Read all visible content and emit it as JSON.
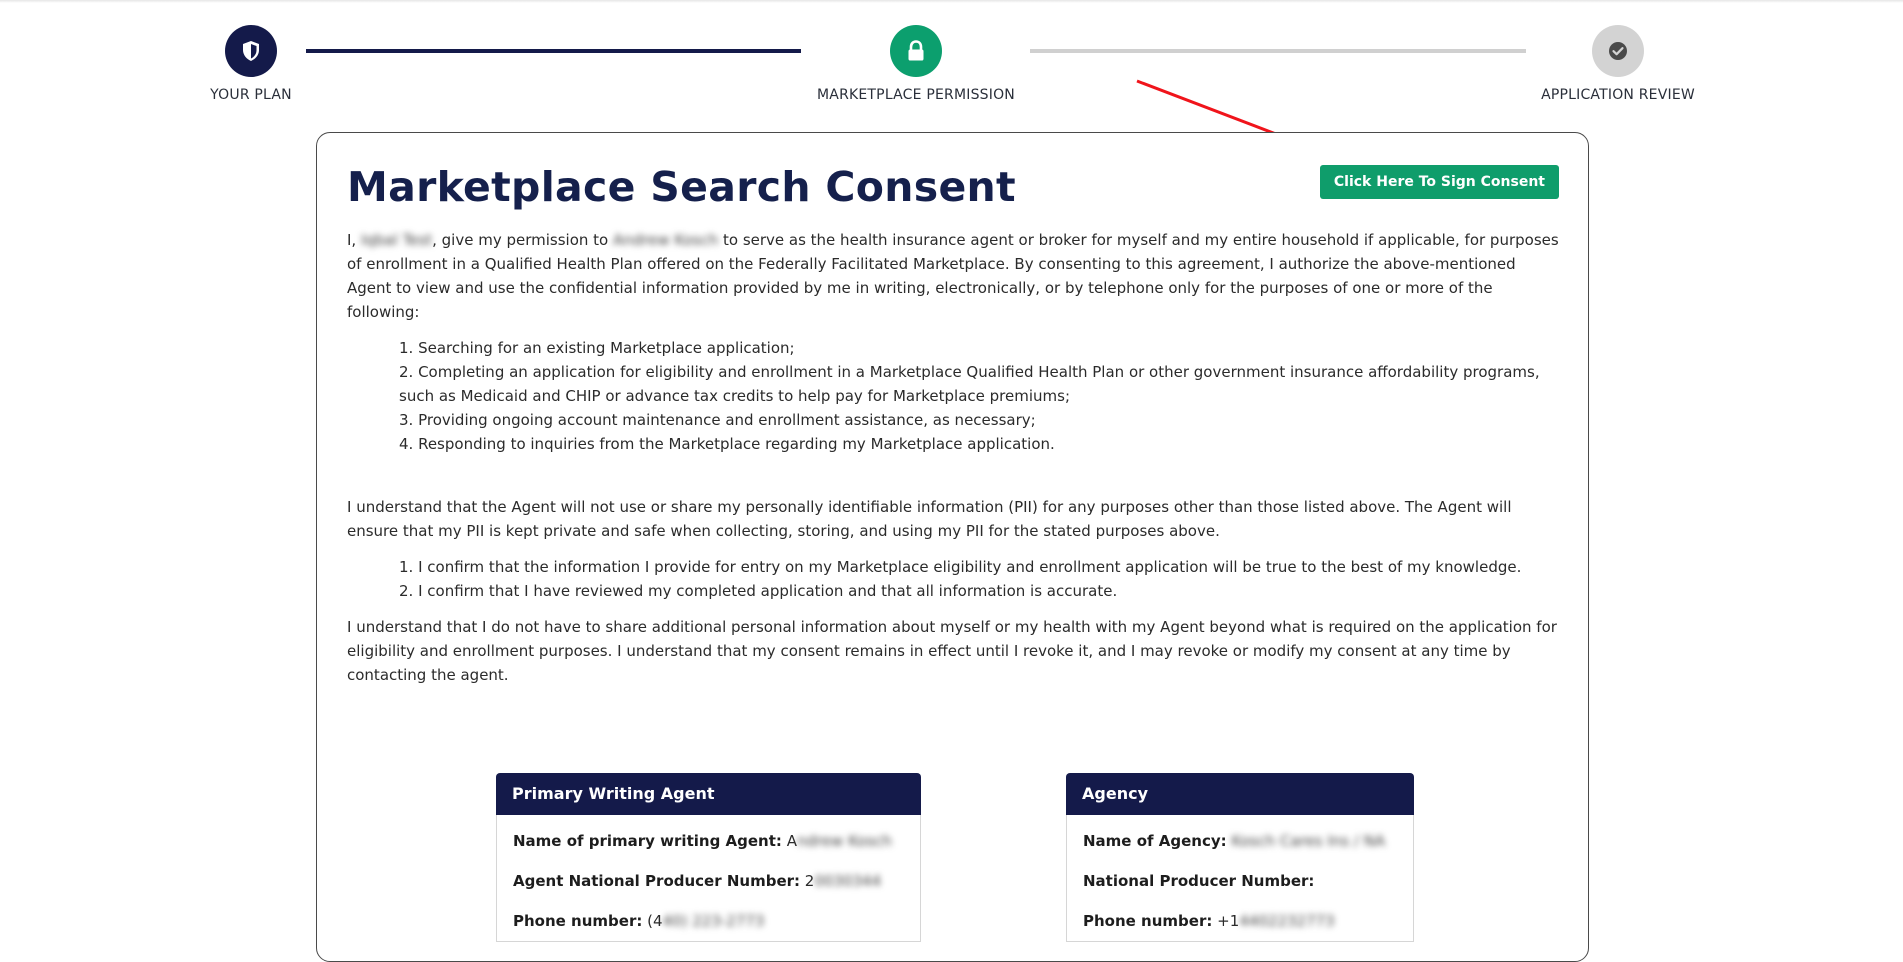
{
  "stepper": {
    "steps": [
      {
        "label": "YOUR PLAN",
        "icon": "shield-icon",
        "state": "completed"
      },
      {
        "label": "MARKETPLACE PERMISSION",
        "icon": "lock-icon",
        "state": "current"
      },
      {
        "label": "APPLICATION REVIEW",
        "icon": "check-icon",
        "state": "pending"
      }
    ]
  },
  "colors": {
    "navy": "#141a4a",
    "green": "#0f9d6b",
    "gray": "#d3d3d3",
    "arrow": "#f0141b"
  },
  "consent": {
    "title": "Marketplace Search Consent",
    "sign_button": "Click Here To Sign Consent",
    "intro": {
      "prefix": "I, ",
      "client_name": "Iqbal Test",
      "mid": ", give my permission to ",
      "agent_name": "Andrew Kosch",
      "suffix": " to serve as the health insurance agent or broker for myself and my entire household if applicable, for purposes of enrollment in a Qualified Health Plan offered on the Federally Facilitated Marketplace. By consenting to this agreement, I authorize the above-mentioned Agent to view and use the confidential information provided by me in writing, electronically, or by telephone only for the purposes of one or more of the following:"
    },
    "purposes": [
      "1. Searching for an existing Marketplace application;",
      "2. Completing an application for eligibility and enrollment in a Marketplace Qualified Health Plan or other government insurance affordability programs, such as Medicaid and CHIP or advance tax credits to help pay for Marketplace premiums;",
      "3. Providing ongoing account maintenance and enrollment assistance, as necessary;",
      "4. Responding to inquiries from the Marketplace regarding my Marketplace application."
    ],
    "pii_paragraph": "I understand that the Agent will not use or share my personally identifiable information (PII) for any purposes other than those listed above. The Agent will ensure that my PII is kept private and safe when collecting, storing, and using my PII for the stated purposes above.",
    "confirmations": [
      "1. I confirm that the information I provide for entry on my Marketplace eligibility and enrollment application will be true to the best of my knowledge.",
      "2. I confirm that I have reviewed my completed application and that all information is accurate."
    ],
    "final_paragraph": "I understand that I do not have to share additional personal information about myself or my health with my Agent beyond what is required on the application for eligibility and enrollment purposes. I understand that my consent remains in effect until I revoke it, and I may revoke or modify my consent at any time by contacting the agent."
  },
  "agent_box": {
    "title": "Primary Writing Agent",
    "name_label": "Name of primary writing Agent:",
    "name_visible": "A",
    "name_hidden": "ndrew Kosch",
    "npn_label": "Agent National Producer Number:",
    "npn_visible": "2",
    "npn_hidden": "0030344",
    "phone_label": "Phone number:",
    "phone_visible": "(4",
    "phone_hidden": "40) 223-2773"
  },
  "agency_box": {
    "title": "Agency",
    "name_label": "Name of Agency:",
    "name_hidden": "Kosch Cares Ins / NA",
    "npn_label": "National Producer Number:",
    "phone_label": "Phone number:",
    "phone_visible": "+1",
    "phone_hidden": "4402232773"
  }
}
